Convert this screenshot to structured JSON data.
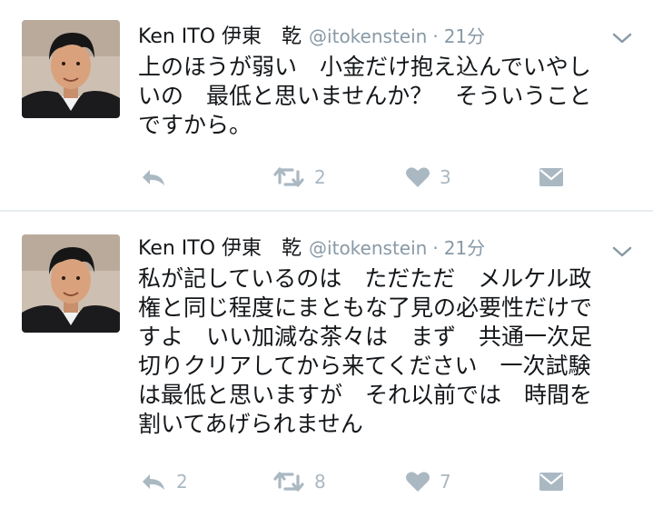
{
  "tweets": [
    {
      "name": "Ken ITO 伊東　乾",
      "handle": "@itokenstein",
      "separator": "·",
      "time": "21分",
      "lines": [
        "上のほうが弱い　小金だけ抱え込んでいやし",
        "いの　最低と思いませんか？　そういうこと",
        "ですから。"
      ],
      "reply_count": "",
      "retweet_count": "2",
      "like_count": "3",
      "icons": {
        "reply": "reply-icon",
        "retweet": "retweet-icon",
        "like": "heart-icon",
        "dm": "direct-message-icon",
        "menu": "chevron-down-icon"
      }
    },
    {
      "name": "Ken ITO 伊東　乾",
      "handle": "@itokenstein",
      "separator": "·",
      "time": "21分",
      "lines": [
        "私が記しているのは　ただただ　メルケル政",
        "権と同じ程度にまともな了見の必要性だけで",
        "すよ　いい加減な茶々は　まず　共通一次足",
        "切りクリアしてから来てください　一次試験",
        "は最低と思いますが　それ以前では　時間を",
        "割いてあげられません"
      ],
      "reply_count": "2",
      "retweet_count": "8",
      "like_count": "7",
      "icons": {
        "reply": "reply-icon",
        "retweet": "retweet-icon",
        "like": "heart-icon",
        "dm": "direct-message-icon",
        "menu": "chevron-down-icon"
      }
    }
  ],
  "colors": {
    "text": "#14171a",
    "secondary": "#8899a6",
    "action_icon": "#aab8c2",
    "divider": "#e6ecf0"
  }
}
